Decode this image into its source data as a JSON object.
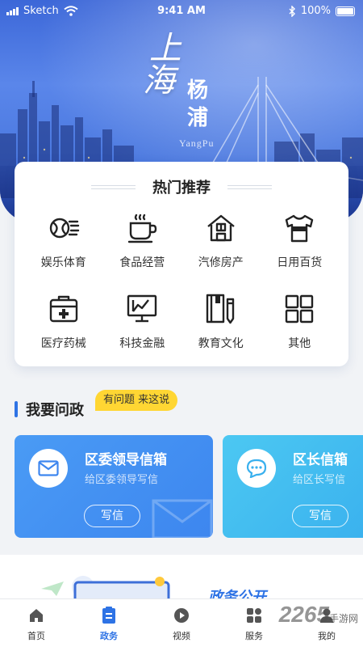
{
  "status_bar": {
    "carrier": "Sketch",
    "time": "9:41 AM",
    "battery": "100%"
  },
  "hero": {
    "title_big": [
      "上",
      "海"
    ],
    "title_small": [
      "杨",
      "浦"
    ],
    "title_en": "YangPu"
  },
  "hot": {
    "title": "热门推荐",
    "items": [
      {
        "label": "娱乐体育",
        "icon": "sports-ball-icon"
      },
      {
        "label": "食品经营",
        "icon": "coffee-cup-icon"
      },
      {
        "label": "汽修房产",
        "icon": "house-icon"
      },
      {
        "label": "日用百货",
        "icon": "shirt-icon"
      },
      {
        "label": "医疗药械",
        "icon": "medical-kit-icon"
      },
      {
        "label": "科技金融",
        "icon": "monitor-chart-icon"
      },
      {
        "label": "教育文化",
        "icon": "book-pen-icon"
      },
      {
        "label": "其他",
        "icon": "grid-icon"
      }
    ]
  },
  "ask": {
    "title": "我要问政",
    "bubble": "有问题 来这说",
    "cards": [
      {
        "title": "区委领导信箱",
        "subtitle": "给区委领导写信",
        "button": "写信",
        "icon": "envelope-icon"
      },
      {
        "title": "区长信箱",
        "subtitle": "给区长写信",
        "button": "写信",
        "icon": "chat-bubble-icon"
      }
    ]
  },
  "bottom": {
    "partial_title": "政务公开"
  },
  "tabbar": {
    "items": [
      {
        "label": "首页",
        "icon": "home-icon",
        "active": false
      },
      {
        "label": "政务",
        "icon": "document-icon",
        "active": true
      },
      {
        "label": "视频",
        "icon": "play-icon",
        "active": false
      },
      {
        "label": "服务",
        "icon": "service-icon",
        "active": false
      },
      {
        "label": "我的",
        "icon": "user-icon",
        "active": false
      }
    ]
  },
  "watermark": {
    "text": "2265",
    "sub": "手游网"
  },
  "colors": {
    "accent": "#2e73e5",
    "bubble": "#ffd633",
    "card_a": "#4a9bf5",
    "card_b": "#4cc8f2"
  }
}
